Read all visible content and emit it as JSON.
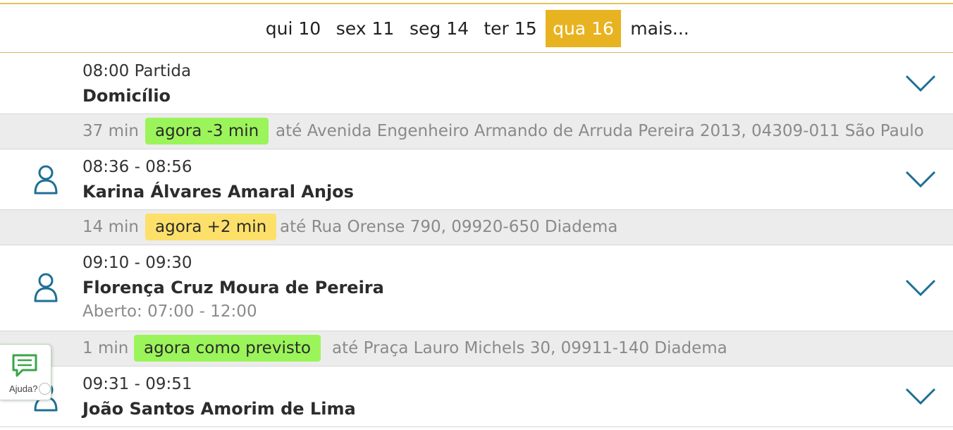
{
  "date_tabs": [
    {
      "label": "qui 10",
      "active": false
    },
    {
      "label": "sex 11",
      "active": false
    },
    {
      "label": "seg 14",
      "active": false
    },
    {
      "label": "ter 15",
      "active": false
    },
    {
      "label": "qua 16",
      "active": true
    },
    {
      "label": "mais...",
      "active": false
    }
  ],
  "stops": [
    {
      "time": "08:00 Partida",
      "name": "Domicílio",
      "icon": "none"
    },
    {
      "time": "08:36 - 08:56",
      "name": "Karina Álvares Amaral Anjos",
      "icon": "person-icon"
    },
    {
      "time": "09:10 - 09:30",
      "name": "Florença Cruz Moura de Pereira",
      "open_hours": "Aberto: 07:00 - 12:00",
      "icon": "person-icon"
    },
    {
      "time": "09:31 - 09:51",
      "name": "João Santos Amorim de Lima",
      "icon": "person-icon"
    }
  ],
  "legs": [
    {
      "duration": "37 min",
      "status": "agora -3 min",
      "status_color": "#9bf55a",
      "destination": "até Avenida Engenheiro Armando de Arruda Pereira 2013, 04309-011 São Paulo"
    },
    {
      "duration": "14 min",
      "status": "agora +2 min",
      "status_color": "#fde06a",
      "destination": "até Rua Orense 790, 09920-650 Diadema"
    },
    {
      "duration": "1 min",
      "status": "agora como previsto",
      "status_color": "#9bf55a",
      "destination": "até Praça Lauro Michels 30, 09911-140 Diadema"
    }
  ],
  "help": {
    "label": "Ajuda?",
    "icon": "chat-icon"
  },
  "colors": {
    "accent": "#e8b321",
    "icon_blue": "#1f6f94",
    "help_green": "#3aa54a",
    "leg_background": "#ececec"
  }
}
